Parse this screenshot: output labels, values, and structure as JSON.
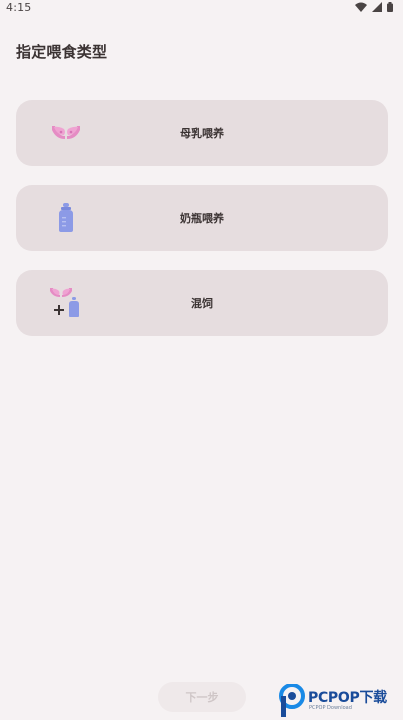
{
  "status_bar": {
    "time": "4:15"
  },
  "page": {
    "title": "指定喂食类型"
  },
  "options": [
    {
      "label": "母乳喂养",
      "icon": "breast-icon"
    },
    {
      "label": "奶瓶喂养",
      "icon": "bottle-icon"
    },
    {
      "label": "混饲",
      "icon": "breast-plus-bottle-icon"
    }
  ],
  "footer": {
    "next_label": "下一步"
  },
  "watermark": {
    "brand": "PCPOP下载",
    "sub": "PCPOP Download"
  },
  "colors": {
    "background": "#f6f2f3",
    "card": "#e6dddf",
    "breast_pink": "#e58cc4",
    "bottle_blue": "#8c9ae6",
    "text_dark": "#3b3333"
  }
}
